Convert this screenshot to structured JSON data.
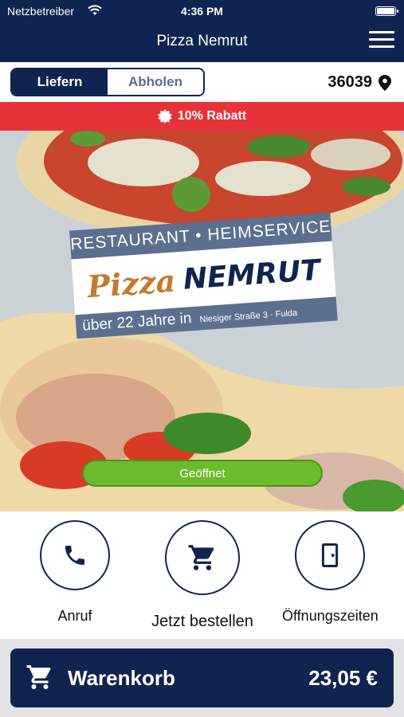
{
  "status_bar": {
    "carrier": "Netzbetreiber",
    "time": "4:36 PM"
  },
  "nav": {
    "title": "Pizza Nemrut",
    "menu_icon": "hamburger-menu-icon"
  },
  "mode_toggle": {
    "options": [
      "Liefern",
      "Abholen"
    ],
    "selected": "Liefern"
  },
  "location": {
    "zip": "36039",
    "icon": "location-pin-icon"
  },
  "discount": {
    "label": "10% Rabatt",
    "icon": "badge-icon",
    "color": "#e8323a"
  },
  "hero": {
    "banner_top": "RESTAURANT • HEIMSERVICE",
    "brand_first": "Pizza",
    "brand_second": "NEMRUT",
    "years": "über 22 Jahre in",
    "address": "Niesiger Straße 3 · Fulda",
    "status": "Geöffnet"
  },
  "actions": [
    {
      "label": "Anruf",
      "icon": "phone-icon"
    },
    {
      "label": "Jetzt bestellen",
      "icon": "cart-icon"
    },
    {
      "label": "Öffnungszeiten",
      "icon": "door-icon"
    }
  ],
  "cart": {
    "label": "Warenkorb",
    "total": "23,05 €",
    "icon": "cart-icon"
  },
  "colors": {
    "primary": "#0f2550",
    "accent_red": "#e8323a",
    "open_green": "#6cbb2b",
    "banner_blue": "#5d6f8f",
    "brand_orange": "#c77a2e"
  }
}
